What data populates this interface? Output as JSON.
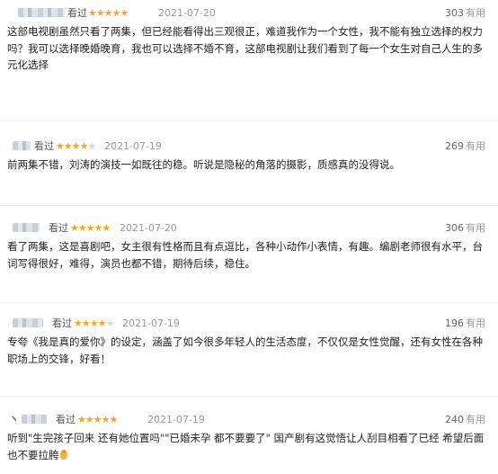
{
  "reviews": [
    {
      "status": "看过",
      "stars_full": "★★★★★",
      "stars_empty": "",
      "rating": 5,
      "date": "2021-07-20",
      "votes": "303",
      "votes_label": "有用",
      "text": "这部电视剧虽然只看了两集，但已经能看得出三观很正，难道我作为一个女性，我不能有独立选择的权力吗？我可以选择晚婚晚育，我也可以选择不婚不育，这部电视剧让我们看到了每一个女生对自己人生的多元化选择"
    },
    {
      "status": "看过",
      "stars_full": "★★★★",
      "stars_empty": "★",
      "rating": 4,
      "date": "2021-07-19",
      "votes": "269",
      "votes_label": "有用",
      "text": "前两集不错，刘涛的演技一如既往的稳。听说是隐秘的角落的摄影，质感真的没得说。"
    },
    {
      "status": "看过",
      "stars_full": "★★★★★",
      "stars_empty": "",
      "rating": 5,
      "date": "2021-07-20",
      "votes": "306",
      "votes_label": "有用",
      "text": "看了两集，这是喜剧吧，女主很有性格而且有点逗比，各种小动作小表情，有趣。编剧老师很有水平，台词写得很好，难得，演员也都不错，期待后续，稳住。"
    },
    {
      "status": "看过",
      "stars_full": "★★★★",
      "stars_empty": "★",
      "rating": 4,
      "date": "2021-07-19",
      "votes": "196",
      "votes_label": "有用",
      "text": "专夸《我是真的爱你》的设定，涵盖了如今很多年轻人的生活态度，不仅仅是女性觉醒，还有女性在各种职场上的交锋，好看！"
    },
    {
      "status": "看过",
      "stars_full": "★★★★★",
      "stars_empty": "",
      "rating": 5,
      "date": "2021-07-19",
      "votes": "240",
      "votes_label": "有用",
      "text": "听到\"生完孩子回来 还有她位置吗\"\"已婚未孕 都不要要了\" 国产剧有这觉悟让人刮目相看了已经 希望后面也不要拉胯",
      "emoji": "flame-icon"
    }
  ],
  "colors": {
    "star": "#f5a623",
    "date": "#9a9a9a",
    "text": "#222222"
  },
  "fragments": {
    "r5_prefix": "ヽ"
  }
}
